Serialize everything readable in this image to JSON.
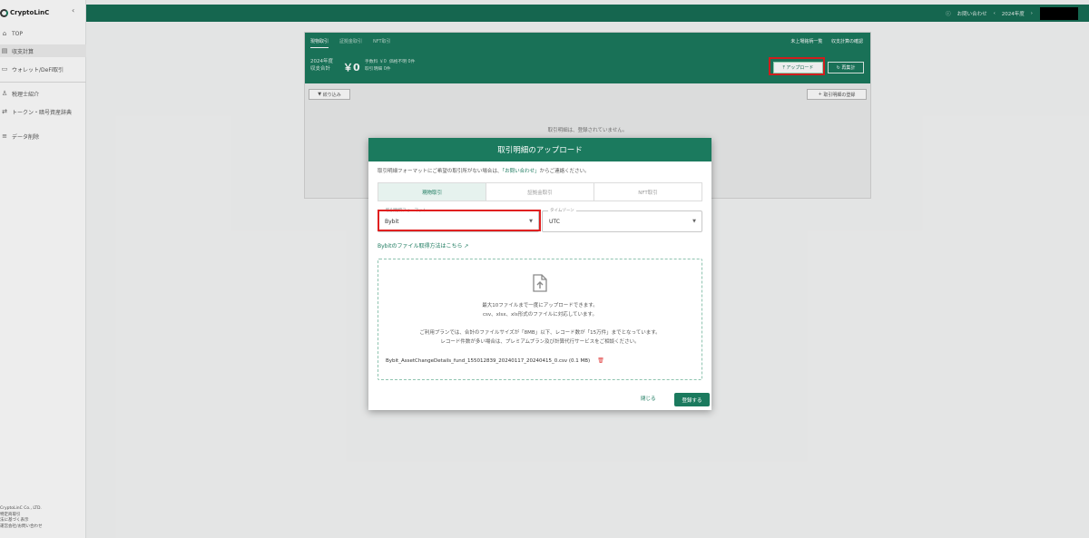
{
  "brand": {
    "name": "CryptoLinC"
  },
  "sidebar": {
    "items": [
      {
        "label": "TOP"
      },
      {
        "label": "収支計算"
      },
      {
        "label": "ウォレット/DeFi取引"
      },
      {
        "label": "税理士紹介"
      },
      {
        "label": "トークン・暗号資産辞典"
      },
      {
        "label": "データ削除"
      }
    ],
    "footer": [
      "CryptoLinC Co., LTD.",
      "特定商取引",
      "法に基づく表示",
      "運営会社/お問い合わせ"
    ]
  },
  "topbar": {
    "contact": "お問い合わせ",
    "year": "2024年度"
  },
  "panel": {
    "tabs": [
      "現物取引",
      "証拠金取引",
      "NFT取引"
    ],
    "links": [
      "未上場銘柄一覧",
      "収支計算の確認"
    ],
    "summary": {
      "year_label": "2024年度",
      "total_label": "収支合計",
      "total_value": "￥0",
      "fee": "手数料 ￥0",
      "unknown": "価格不明 0件",
      "count": "取引明細 0件"
    },
    "upload_button": "アップロード",
    "recalc_button": "再集計",
    "filter_button": "絞り込み",
    "add_button": "取引明細の登録",
    "empty_message": "取引明細は、登録されていません。"
  },
  "modal": {
    "title": "取引明細のアップロード",
    "notice_before": "取引明細フォーマットにご希望の取引所がない場合は、",
    "notice_link": "「お問い合わせ」",
    "notice_after": "からご連絡ください。",
    "tabs": [
      "現物取引",
      "証拠金取引",
      "NFT取引"
    ],
    "format_field": {
      "label": "取引明細フォーマット",
      "value": "Bybit"
    },
    "timezone_field": {
      "label": "タイムゾーン",
      "value": "UTC"
    },
    "guide_link": "Bybitのファイル取得方法はこちら",
    "drop": {
      "line1": "最大10ファイルまで一度にアップロードできます。",
      "line2": "csv、xlsx、xls形式のファイルに対応しています。",
      "line3": "ご利用プランでは、合計のファイルサイズが「8MB」以下、レコード数が「15万件」までとなっています。",
      "line4": "レコード件数が多い場合は、プレミアムプラン及び計算代行サービスをご相談ください。"
    },
    "file": "Bybit_AssetChangeDetails_fund_155012839_20240117_20240415_0.csv (0.1 MB)",
    "close_button": "閉じる",
    "register_button": "登録する"
  },
  "colors": {
    "brand_green": "#1b7a5e",
    "highlight_red": "#e02020"
  },
  "icons": [
    "home-icon",
    "calculator-icon",
    "wallet-icon",
    "advisor-icon",
    "dictionary-icon",
    "delete-icon",
    "help-icon",
    "filter-icon",
    "plus-icon",
    "upload-icon",
    "refresh-icon",
    "file-upload-icon",
    "external-link-icon",
    "trash-icon",
    "chevron-down-icon"
  ]
}
